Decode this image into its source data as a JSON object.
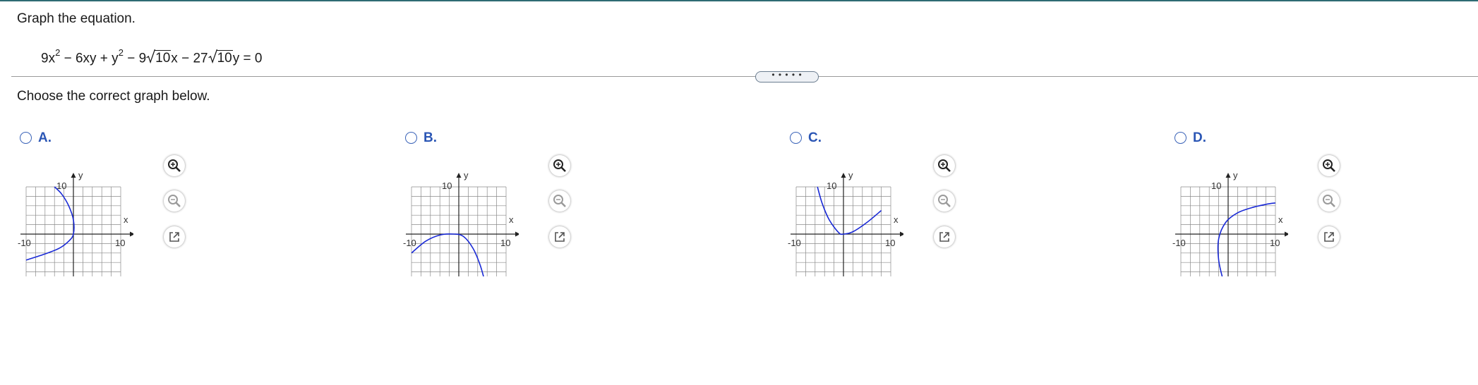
{
  "question": {
    "text": "Graph the equation."
  },
  "equation": {
    "p1": "9x",
    "sup1": "2",
    "p2": " − 6xy + y",
    "sup2": "2",
    "p3": " − 9",
    "rad1": "10",
    "p4": "x − 27",
    "rad2": "10",
    "p5": "y = 0"
  },
  "divider_handle": "• • • • •",
  "prompt": "Choose the correct graph below.",
  "graph_axes": {
    "x_label": "x",
    "y_label": "y",
    "tick_pos": "10",
    "tick_neg": "-10",
    "range": [
      -10,
      10
    ]
  },
  "colors": {
    "accent": "#2b56b5",
    "curve": "#1a2ad6",
    "grid": "#8a8a8a",
    "topline": "#2e6b73"
  },
  "tools": {
    "zoom_in": "zoom-in-icon",
    "zoom_out": "zoom-out-icon",
    "open_window": "open-window-icon"
  },
  "choices": [
    {
      "label": "A.",
      "selected": false
    },
    {
      "label": "B.",
      "selected": false
    },
    {
      "label": "C.",
      "selected": false
    },
    {
      "label": "D.",
      "selected": false
    }
  ],
  "chart_data": [
    {
      "type": "line",
      "choice": "A",
      "xlim": [
        -10,
        10
      ],
      "ylim": [
        -10,
        10
      ],
      "grid": true,
      "series": [
        {
          "x": [
            -10,
            -6,
            -3,
            -1,
            0,
            0,
            -1,
            -2.5,
            -4
          ],
          "y": [
            -5.5,
            -4.2,
            -3,
            -1.5,
            0,
            3,
            6,
            8.5,
            10
          ]
        }
      ]
    },
    {
      "type": "line",
      "choice": "B",
      "xlim": [
        -10,
        10
      ],
      "ylim": [
        -10,
        10
      ],
      "grid": true,
      "series": [
        {
          "x": [
            -10,
            -7,
            -4,
            -1,
            1,
            3,
            4.5,
            5.5
          ],
          "y": [
            -4,
            -1.5,
            -0.2,
            0,
            -0.5,
            -3,
            -6.5,
            -10
          ]
        }
      ]
    },
    {
      "type": "line",
      "choice": "C",
      "xlim": [
        -10,
        10
      ],
      "ylim": [
        -10,
        10
      ],
      "grid": true,
      "series": [
        {
          "x": [
            -5.5,
            -4.5,
            -3,
            -1,
            0,
            2,
            5,
            8
          ],
          "y": [
            10,
            6.5,
            3,
            0.3,
            0,
            0.5,
            2.5,
            5
          ]
        }
      ]
    },
    {
      "type": "line",
      "choice": "D",
      "xlim": [
        -10,
        10
      ],
      "ylim": [
        -10,
        10
      ],
      "grid": true,
      "series": [
        {
          "x": [
            -1,
            -2,
            -2,
            -0.5,
            2,
            5,
            8,
            10
          ],
          "y": [
            -10,
            -5.5,
            -1,
            2.5,
            4.5,
            5.6,
            6.3,
            6.6
          ]
        }
      ]
    }
  ]
}
